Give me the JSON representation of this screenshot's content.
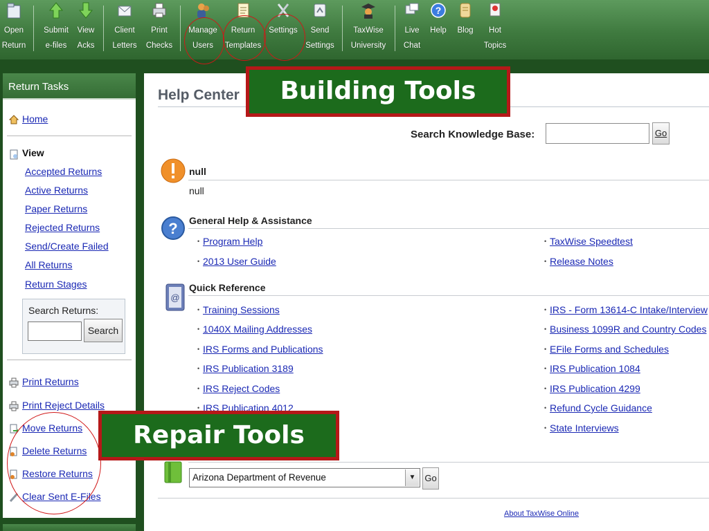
{
  "toolbar": {
    "buttons": [
      {
        "id": "open-return",
        "line1": "Open",
        "line2": "Return",
        "icon": "folder-icon"
      },
      {
        "id": "submit-efiles",
        "line1": "Submit",
        "line2": "e-files",
        "icon": "up-arrow-icon"
      },
      {
        "id": "view-acks",
        "line1": "View",
        "line2": "Acks",
        "icon": "down-arrow-icon"
      },
      {
        "id": "client-letters",
        "line1": "Client",
        "line2": "Letters",
        "icon": "envelope-icon"
      },
      {
        "id": "print-checks",
        "line1": "Print",
        "line2": "Checks",
        "icon": "printer-icon"
      },
      {
        "id": "manage-users",
        "line1": "Manage",
        "line2": "Users",
        "icon": "users-icon"
      },
      {
        "id": "return-templates",
        "line1": "Return",
        "line2": "Templates",
        "icon": "templates-icon"
      },
      {
        "id": "settings",
        "line1": "Settings",
        "line2": "",
        "icon": "wrench-icon"
      },
      {
        "id": "send-settings",
        "line1": "Send",
        "line2": "Settings",
        "icon": "send-icon"
      },
      {
        "id": "taxwise-university",
        "line1": "TaxWise",
        "line2": "University",
        "icon": "graduate-icon"
      },
      {
        "id": "live-chat",
        "line1": "Live",
        "line2": "Chat",
        "icon": "chat-icon"
      },
      {
        "id": "help",
        "line1": "Help",
        "line2": "",
        "icon": "help-icon"
      },
      {
        "id": "blog",
        "line1": "Blog",
        "line2": "",
        "icon": "scroll-icon"
      },
      {
        "id": "hot-topics",
        "line1": "Hot",
        "line2": "Topics",
        "icon": "hot-topics-icon"
      }
    ]
  },
  "sidebar": {
    "title": "Return Tasks",
    "home": "Home",
    "view_heading": "View",
    "view_links": [
      "Accepted Returns",
      "Active Returns",
      "Paper Returns",
      "Rejected Returns",
      "Send/Create Failed",
      "All Returns",
      "Return Stages"
    ],
    "search_label": "Search Returns:",
    "search_value": "",
    "search_button": "Search",
    "tools": [
      {
        "label": "Print Returns",
        "icon": "printer-icon"
      },
      {
        "label": "Print Reject Details",
        "icon": "printer-icon"
      },
      {
        "label": "Move Returns",
        "icon": "move-icon"
      },
      {
        "label": "Delete Returns",
        "icon": "delete-icon"
      },
      {
        "label": "Restore Returns",
        "icon": "restore-icon"
      },
      {
        "label": "Clear Sent E-Files",
        "icon": "clear-icon"
      }
    ]
  },
  "main": {
    "title": "Help Center",
    "search_label": "Search Knowledge Base:",
    "search_value": "",
    "search_go": "Go",
    "alert": {
      "title": "null",
      "text": "null"
    },
    "general": {
      "title": "General Help & Assistance",
      "left": [
        "Program Help",
        "2013 User Guide"
      ],
      "right": [
        "TaxWise Speedtest",
        "Release Notes"
      ]
    },
    "quick": {
      "title": "Quick Reference",
      "left": [
        "Training Sessions",
        "1040X Mailing Addresses",
        "IRS Forms and Publications",
        "IRS Publication 3189",
        "IRS Reject Codes",
        "IRS Publication 4012"
      ],
      "right": [
        "IRS - Form 13614-C Intake/Interview",
        "Business 1099R and Country Codes",
        "EFile Forms and Schedules",
        "IRS Publication 1084",
        "IRS Publication 4299",
        "Refund Cycle Guidance",
        "State Interviews"
      ]
    },
    "state_select": "Arizona Department of Revenue",
    "state_go": "Go",
    "footer_link": "About TaxWise Online"
  },
  "callouts": {
    "building": "Building Tools",
    "repair": "Repair Tools"
  },
  "colors": {
    "toolbar": "#3f7a3f",
    "link": "#1a28b4",
    "callout_bg": "#1c6b1c",
    "callout_border": "#b51818",
    "highlight_ring": "#d01818"
  }
}
